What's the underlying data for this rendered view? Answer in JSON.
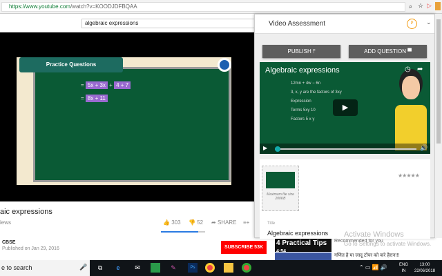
{
  "browser": {
    "url_host": "https://www.youtube.com",
    "url_path": "/watch?v=KOODJDFBQAA"
  },
  "youtube": {
    "search_value": "algebraic expressions",
    "video": {
      "tab_title": "Practice Questions",
      "line1_prefix": "=",
      "line1_a": "5x + 3x",
      "line1_plus": "+",
      "line1_b": "4  +  7",
      "line2_prefix": "=",
      "line2_a": "8x + 11"
    },
    "title_fragment": "aic expressions",
    "views_fragment": "iews",
    "likes": "303",
    "dislikes": "52",
    "share_label": "SHARE",
    "like_ratio": 0.85,
    "channel": "CBSE",
    "published": "Published on Jan 29, 2016",
    "subscribe_label": "SUBSCRIBE",
    "subscriber_count": "53K",
    "recommended": [
      {
        "thumb_text": "4 Practical Tips",
        "duration": "4:54",
        "label": "Recommended for you"
      },
      {
        "title": "गणित है या जादू टॉपर को करे हैरान!!!"
      }
    ]
  },
  "panel": {
    "title": "Video Assessment",
    "avatar_letter": "P",
    "publish_label": "PUBLISH",
    "add_question_label": "ADD QUESTION",
    "preview": {
      "title": "Algebraic expressions",
      "math": [
        "12mn + 4w − 6n",
        "3, x, y are the factors of 3xy",
        "Expression",
        "Terms      5xy            10",
        "Factors   5  x  y"
      ]
    },
    "card": {
      "upload_note": "Maximum file size 200KB",
      "stars": "★★★★★",
      "title_label": "Title",
      "title_value": "Algebraic expressions"
    }
  },
  "watermark": {
    "line1": "Activate Windows",
    "line2": "Go to Settings to activate Windows."
  },
  "taskbar": {
    "search_placeholder": "e to search",
    "lang": "ENG",
    "region": "IN",
    "time": "13:00",
    "date": "22/06/2018"
  },
  "colors": {
    "subscribe": "#ff0000",
    "board": "#0a5a35",
    "highlight": "#9a6ad0",
    "button": "#5e5e5e",
    "avatar": "#f39c12"
  }
}
